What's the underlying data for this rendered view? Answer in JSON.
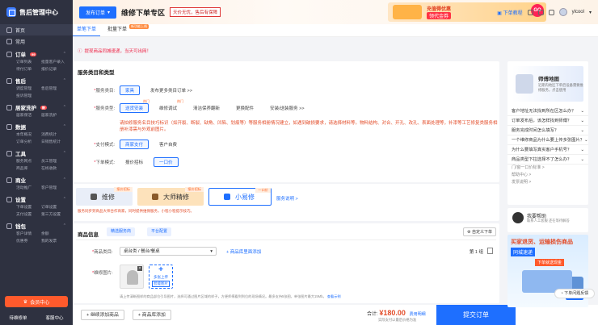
{
  "app": {
    "title": "售后管理中心"
  },
  "sidebar": {
    "home": "首页",
    "common": "常用",
    "sections": [
      {
        "title": "订单",
        "items": [
          "订单列表",
          "批量客户录入",
          "待付订单",
          "报价记录"
        ],
        "badge": "99"
      },
      {
        "title": "售后",
        "items": [
          "调度管理",
          "售后管理",
          "投诉管理"
        ],
        "badge": ""
      },
      {
        "title": "居家洗护",
        "items": [
          "居家保洁",
          "居家洗护"
        ],
        "badge": "新"
      },
      {
        "title": "数据",
        "items": [
          "本年概况",
          "消费统计",
          "订单分析",
          "日销售统计"
        ],
        "badge": ""
      },
      {
        "title": "工具",
        "items": [
          "服务网点",
          "员工管理",
          "商品库",
          "在线收款"
        ],
        "badge": ""
      },
      {
        "title": "商业",
        "items": [
          "活动推广",
          "客户管理"
        ],
        "badge": ""
      },
      {
        "title": "设置",
        "items": [
          "下单设置",
          "订单设置",
          "支付设置",
          "第三方设置"
        ],
        "badge": ""
      },
      {
        "title": "钱包",
        "items": [
          "客户详情",
          "余额",
          "优惠券",
          "我的发票"
        ],
        "badge": ""
      }
    ],
    "upgrade": "会员中心",
    "footer": [
      "待维修单",
      "客服中心"
    ]
  },
  "topbar": {
    "publish": "发布订单",
    "title": "维修下单专区",
    "slogan": "天价无忧，售后有保障",
    "banner_line1": "充值得优惠",
    "banner_line2": "领代金券",
    "banner_chip": "GO",
    "tutorial": "下单教程",
    "username": "ylcool"
  },
  "tabs": [
    {
      "label": "单笔下单",
      "active": true,
      "tag": ""
    },
    {
      "label": "批量下单",
      "active": false,
      "tag": "新功能上线"
    }
  ],
  "notice": "提现商品同城速递，当天可出网！",
  "service": {
    "title": "服务类目和类型",
    "category": {
      "label": "服务类目",
      "selected": "家具",
      "more": "发布更多类目订单 >>"
    },
    "type": {
      "label": "服务类型",
      "options": [
        {
          "text": "送货安装",
          "tag": "热门"
        },
        {
          "text": "维修调试",
          "tag": "热门"
        },
        {
          "text": "清洁保养翻新",
          "tag": ""
        },
        {
          "text": "更换配件",
          "tag": ""
        },
        {
          "text": "安装/送装服务 >>",
          "tag": ""
        }
      ]
    },
    "warning": "请拍修服务名目技巧标识（如开裂、断裂、缺角、凹陷、划痕等）等服务相册情况建立，如遇到破损要求，请选择材料等。物料结构、对合、开孔、改孔、表面处理等，补漆等工艺修复类服务相册补漆需与外观前图片。",
    "payment": {
      "label": "支付模式",
      "options": [
        "商家支付",
        "客户自费"
      ]
    },
    "order_mode": {
      "label": "下单模式",
      "options": [
        "报价招标",
        "一口价"
      ]
    }
  },
  "types": [
    {
      "name": "维修",
      "tag": "报价招标"
    },
    {
      "name": "大师精修",
      "tag": "报价招标"
    },
    {
      "name": "小易修",
      "tag": "一口价"
    }
  ],
  "types_link": "服务说明 >",
  "types_note": "服务同步到商品大师合作商家，同时提供维保服务，小程小程提示技巧。",
  "goods": {
    "title": "商品信息",
    "chip1": "精选服务商",
    "chip2": "平台配置",
    "custom": "自定义下单",
    "category_label": "商品类目",
    "category_value": "桌台类 / 餐台/餐桌",
    "add_link": "+ 商品库里面添加",
    "page": "第 1 组",
    "image_label": "维修图片",
    "upload_text": "多张上传",
    "upload_btn": "智能图片",
    "note": "请上传清晰图样的商品部位引导图片，选择可通过图片区域的样子，方便师傅看到到位的现场情况。最多支持5张图，单张图片最大15Mb。",
    "note_link": "查看示例"
  },
  "bottom": {
    "btn_service": "+ 继续添加商品",
    "btn_goods": "+ 商品库添加",
    "total_label": "合计:",
    "total": "¥180.00",
    "detail": "费用明细",
    "sub": "实际支付以最后价格为准",
    "submit": "提交订单"
  },
  "guide": {
    "title": "师傅地图",
    "desc": "近期内地区下单后设备需要维修服务，点击使用",
    "questions": [
      "客户地址无法找到所在区怎么办？",
      "订单发布后，该怎样找到师傅？",
      "服务完成时间怎么填写？",
      "一个维修商品为什么要上传多张图片？",
      "为什么要填写真实客户手机号？",
      "商品类型下拉选择不了怎么办？"
    ],
    "links": [
      "门/窗一口价标准 >",
      "帮助中心 >",
      "发票说明 >"
    ]
  },
  "help": {
    "title": "我要帮助",
    "desc": "联系人工客服 还在等待解答"
  },
  "ad": {
    "line1": "买家退货、运输损伤商品",
    "line2": "同城速递",
    "line3": "下单就送现金",
    "btn": "免费"
  },
  "float": "下单问题反馈"
}
